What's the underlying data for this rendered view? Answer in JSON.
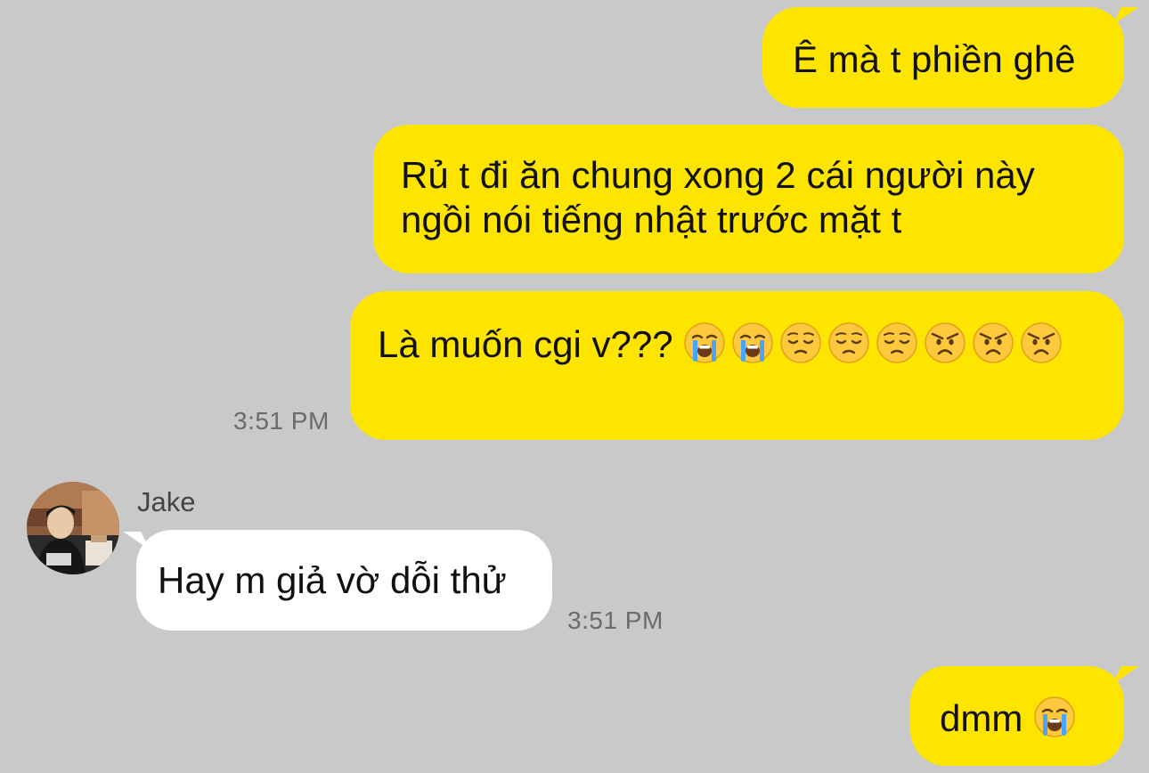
{
  "conversation": {
    "messages": [
      {
        "direction": "outgoing",
        "text": "Ê mà t phiền ghê"
      },
      {
        "direction": "outgoing",
        "text": "Rủ t đi ăn chung xong 2 cái người này ngồi nói tiếng nhật trước mặt t"
      },
      {
        "direction": "outgoing",
        "text": "Là muốn cgi v???",
        "emojis": [
          "loudly-crying-face",
          "loudly-crying-face",
          "pensive-face",
          "pensive-face",
          "pensive-face",
          "angry-face",
          "angry-face",
          "angry-face"
        ],
        "time": "3:51 PM"
      },
      {
        "direction": "incoming",
        "sender": "Jake",
        "text": "Hay m giả vờ dỗi thử",
        "time": "3:51 PM"
      },
      {
        "direction": "outgoing",
        "text": "dmm",
        "emojis": [
          "loudly-crying-face"
        ]
      }
    ]
  },
  "colors": {
    "background": "#c9c9c9",
    "outgoing_bubble": "#fee500",
    "incoming_bubble": "#ffffff"
  }
}
